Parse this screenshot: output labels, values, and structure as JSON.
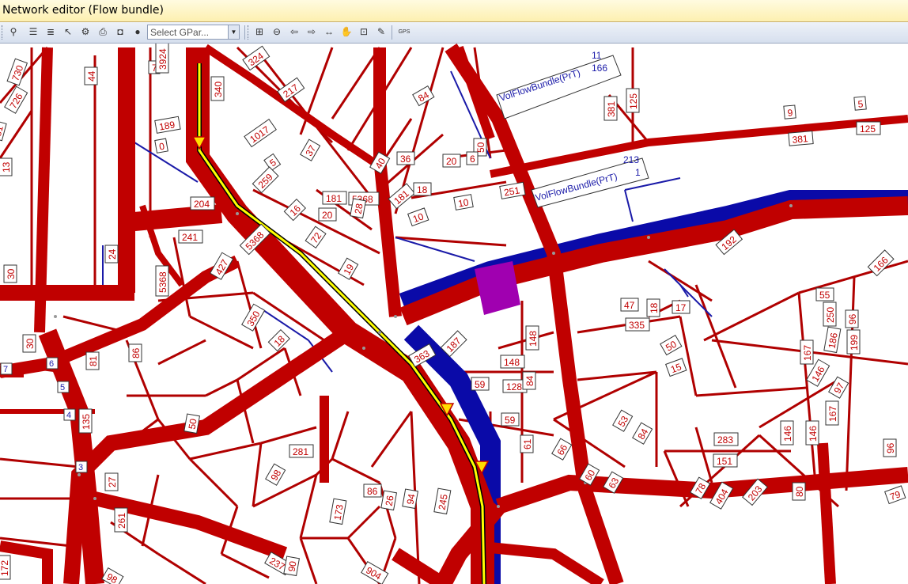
{
  "window": {
    "title": "Network editor (Flow bundle)"
  },
  "toolbar": {
    "select_placeholder": "Select GPar...",
    "tools": [
      "binoculars-icon",
      "list-icon",
      "layers-icon",
      "select-pointer-icon",
      "network-icon",
      "print-icon",
      "camera-icon",
      "globe-icon",
      "zoom-window-icon",
      "zoom-out-icon",
      "back-icon",
      "forward-icon",
      "fit-width-icon",
      "pan-hand-icon",
      "zoom-page-icon",
      "edit-icon",
      "gps-icon"
    ],
    "gps_label": "GPS"
  },
  "map": {
    "bundle_labels": [
      {
        "text": "VolFlowBundle(PrT)",
        "a": "11",
        "b": "166"
      },
      {
        "text": "VolFlowBundle(PrT)",
        "a": "213",
        "b": "1"
      }
    ],
    "link_labels": [
      "730",
      "726",
      "81",
      "13",
      "44",
      "7",
      "3924",
      "340",
      "324",
      "217",
      "84",
      "189",
      "0",
      "1017",
      "37",
      "36",
      "40",
      "50",
      "20",
      "6",
      "5",
      "259",
      "16",
      "181",
      "5368",
      "20",
      "28",
      "181",
      "18",
      "10",
      "10",
      "251",
      "241",
      "204",
      "427",
      "30",
      "24",
      "72",
      "19",
      "5368",
      "5368",
      "350",
      "18",
      "9",
      "5",
      "381",
      "125",
      "381",
      "125",
      "192",
      "166",
      "55",
      "250",
      "96",
      "186",
      "199",
      "167",
      "146",
      "97",
      "167",
      "146",
      "146",
      "96",
      "79",
      "47",
      "335",
      "18",
      "17",
      "50",
      "15",
      "148",
      "128",
      "148",
      "84",
      "59",
      "59",
      "61",
      "66",
      "53",
      "84",
      "283",
      "151",
      "63",
      "60",
      "78",
      "404",
      "203",
      "80",
      "187",
      "363",
      "281",
      "50",
      "86",
      "81",
      "98",
      "86",
      "26",
      "94",
      "245",
      "173",
      "237",
      "90",
      "904",
      "98",
      "172",
      "135",
      "27",
      "261",
      "30",
      "3",
      "70",
      "7",
      "6",
      "5",
      "4",
      "3"
    ],
    "node_labels": [
      "7",
      "6",
      "5",
      "4",
      "3"
    ]
  },
  "colors": {
    "flow_red": "#c00000",
    "flow_blue": "#0a0aa8",
    "flow_purple": "#a000b0",
    "link_thin": "#8a0000",
    "path_yellow": "#ffff00"
  }
}
